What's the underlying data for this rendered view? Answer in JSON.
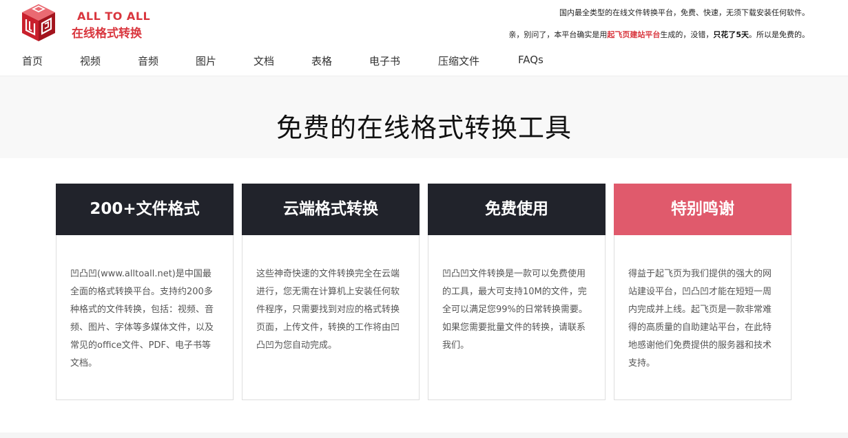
{
  "brand": {
    "en": "ALL TO ALL",
    "cn": "在线格式转换"
  },
  "top_note": {
    "line1": "国内最全类型的在线文件转换平台，免费、快速，无须下载安装任何软件。",
    "line2_a": "亲，别问了，本平台确实是用",
    "line2_link": "起飞页建站平台",
    "line2_b": "生成的，没错，",
    "line2_bold": "只花了5天",
    "line2_c": "。所以是免费的。"
  },
  "nav": {
    "items": [
      "首页",
      "视频",
      "音频",
      "图片",
      "文档",
      "表格",
      "电子书",
      "压缩文件",
      "FAQs"
    ]
  },
  "hero": {
    "title": "免费的在线格式转换工具"
  },
  "cards": [
    {
      "title": "200+文件格式",
      "body": "凹凸凹(www.alltoall.net)是中国最全面的格式转换平台。支持约200多种格式的文件转换，包括：视频、音频、图片、字体等多媒体文件，以及常见的office文件、PDF、电子书等文档。"
    },
    {
      "title": "云端格式转换",
      "body": "这些神奇快速的文件转换完全在云端进行，您无需在计算机上安装任何软件程序，只需要找到对应的格式转换页面，上传文件，转换的工作将由凹凸凹为您自动完成。"
    },
    {
      "title": "免费使用",
      "body": "凹凸凹文件转换是一款可以免费使用的工具，最大可支持10M的文件，完全可以满足您99%的日常转换需要。如果您需要批量文件的转换，请联系我们。"
    },
    {
      "title": "特别鸣谢",
      "body": "得益于起飞页为我们提供的强大的网站建设平台，凹凸凹才能在短短一周内完成并上线。起飞页是一款非常难得的高质量的自助建站平台，在此特地感谢他们免费提供的服务器和技术支持。"
    }
  ],
  "colors": {
    "brand_red": "#d9363e",
    "card_dark": "#21232b",
    "card_pink": "#e05a6c"
  }
}
